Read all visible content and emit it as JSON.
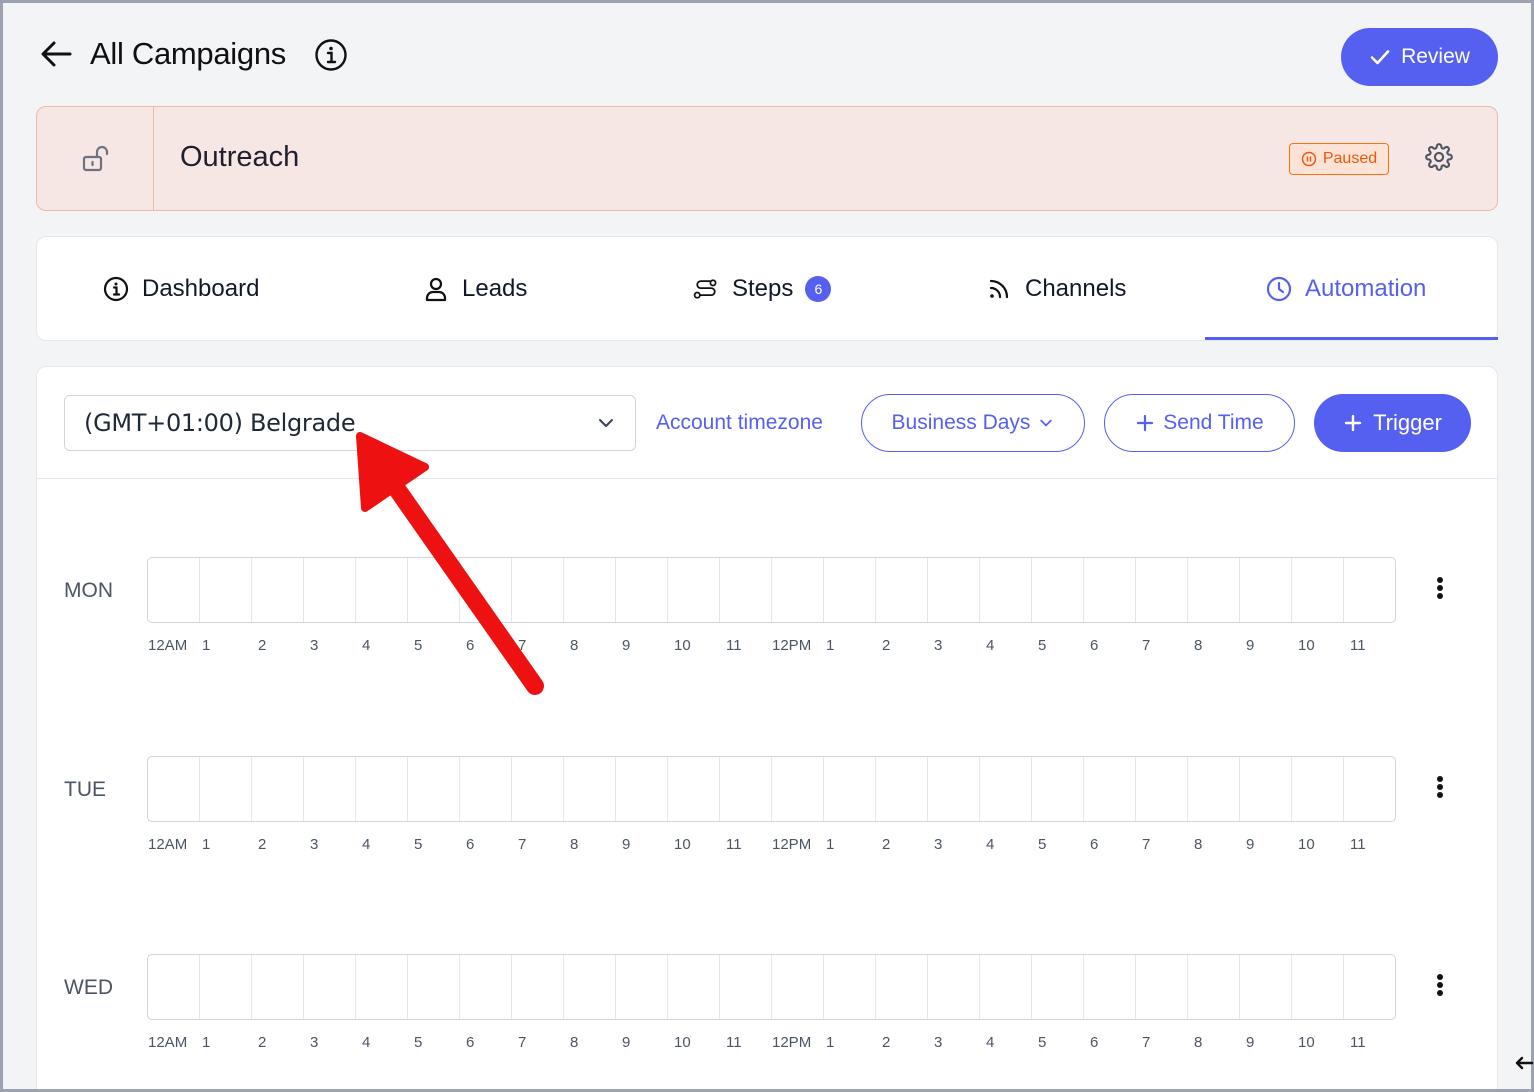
{
  "header": {
    "title": "All Campaigns",
    "review_label": "Review"
  },
  "campaign": {
    "name": "Outreach",
    "status": "Paused"
  },
  "tabs": [
    {
      "label": "Dashboard",
      "icon": "info-circle-icon"
    },
    {
      "label": "Leads",
      "icon": "user-icon"
    },
    {
      "label": "Steps",
      "icon": "steps-icon",
      "badge": "6"
    },
    {
      "label": "Channels",
      "icon": "rss-icon"
    },
    {
      "label": "Automation",
      "icon": "clock-icon",
      "active": true
    }
  ],
  "toolbar": {
    "timezone": "(GMT+01:00) Belgrade",
    "account_timezone": "Account timezone",
    "business_days": "Business Days",
    "send_time": "Send Time",
    "trigger": "Trigger"
  },
  "schedule": {
    "days": [
      "MON",
      "TUE",
      "WED"
    ],
    "hours": [
      "12AM",
      "1",
      "2",
      "3",
      "4",
      "5",
      "6",
      "7",
      "8",
      "9",
      "10",
      "11",
      "12PM",
      "1",
      "2",
      "3",
      "4",
      "5",
      "6",
      "7",
      "8",
      "9",
      "10",
      "11"
    ]
  },
  "colors": {
    "accent": "#5560f0",
    "paused": "#ea580c",
    "campaign_bg": "#f7e7e4",
    "annotation_arrow": "#ee1111"
  }
}
